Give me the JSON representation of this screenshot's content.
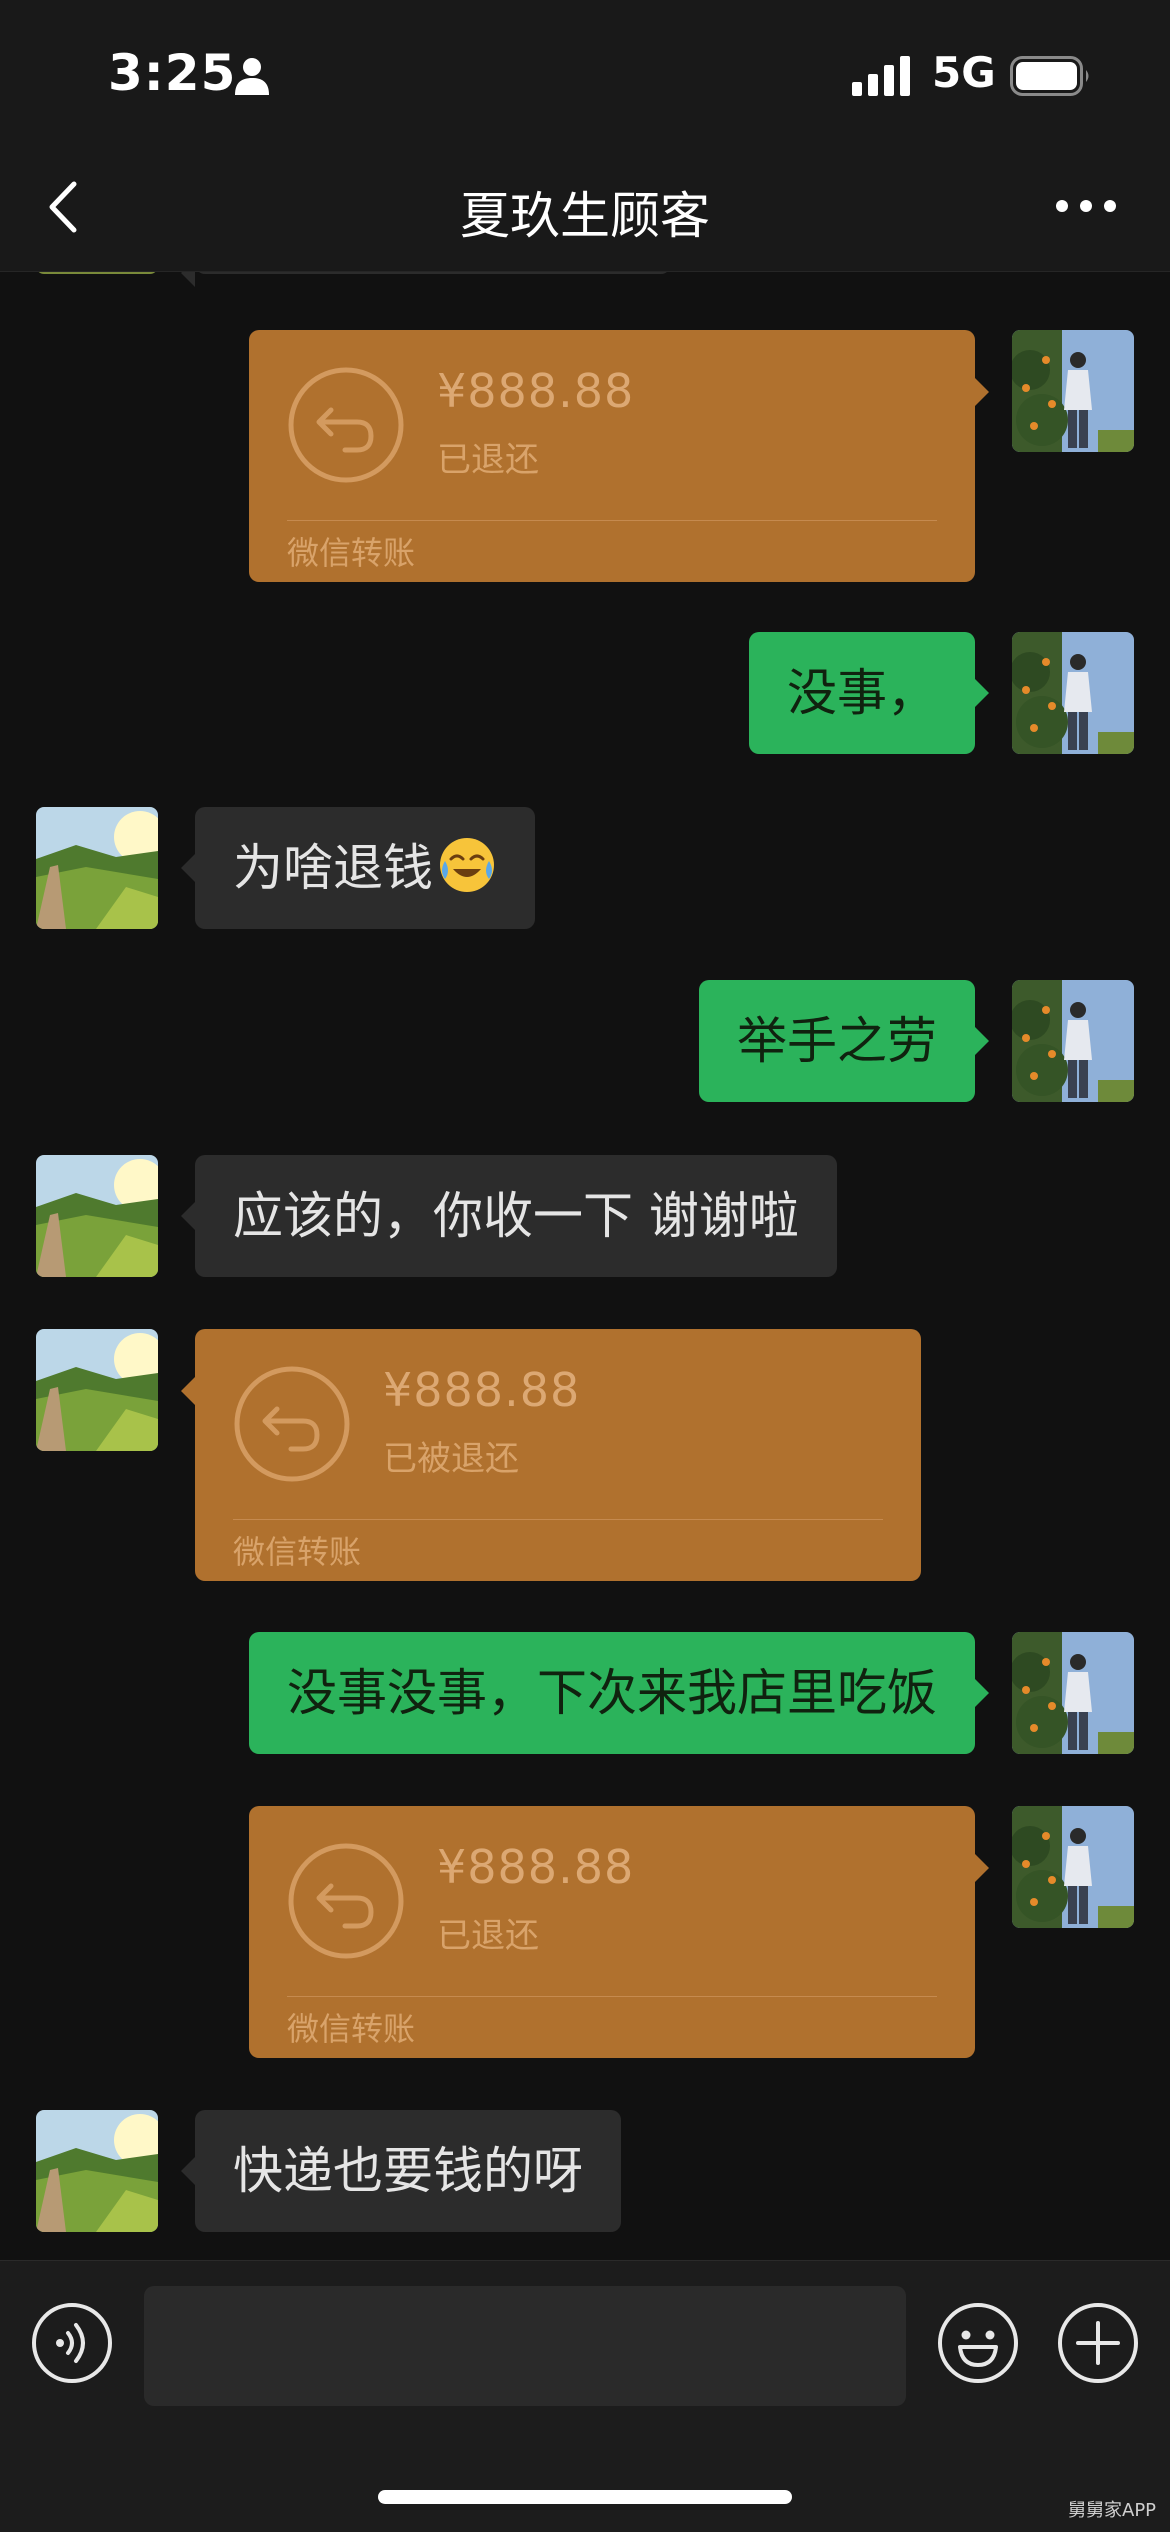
{
  "status_bar": {
    "time": "3:25",
    "network": "5G",
    "icons": [
      "person-icon",
      "signal-icon",
      "battery-icon"
    ]
  },
  "nav": {
    "title": "夏玖生顾客",
    "back_icon": "chevron-left-icon",
    "more_icon": "more-dots-icon"
  },
  "messages": [
    {
      "side": "out",
      "type": "transfer",
      "amount": "¥888.88",
      "status": "已退还",
      "footer": "微信转账"
    },
    {
      "side": "out",
      "type": "text",
      "text": "没事，"
    },
    {
      "side": "in",
      "type": "text",
      "text": "为啥退钱",
      "emoji": "crying-laughing-emoji"
    },
    {
      "side": "out",
      "type": "text",
      "text": "举手之劳"
    },
    {
      "side": "in",
      "type": "text",
      "text": "应该的，你收一下 谢谢啦"
    },
    {
      "side": "in",
      "type": "transfer",
      "amount": "¥888.88",
      "status": "已被退还",
      "footer": "微信转账"
    },
    {
      "side": "out",
      "type": "text",
      "text": "没事没事，下次来我店里吃饭"
    },
    {
      "side": "out",
      "type": "transfer",
      "amount": "¥888.88",
      "status": "已退还",
      "footer": "微信转账"
    },
    {
      "side": "in",
      "type": "text",
      "text": "快递也要钱的呀"
    }
  ],
  "input_bar": {
    "placeholder": "",
    "icons": [
      "voice-icon",
      "emoji-icon",
      "plus-icon"
    ]
  },
  "watermark": "舅舅家APP",
  "colors": {
    "background": "#111111",
    "bar": "#191919",
    "incoming_bubble": "#2c2c2c",
    "outgoing_bubble": "#2bb35b",
    "transfer_card": "#b0712e"
  }
}
